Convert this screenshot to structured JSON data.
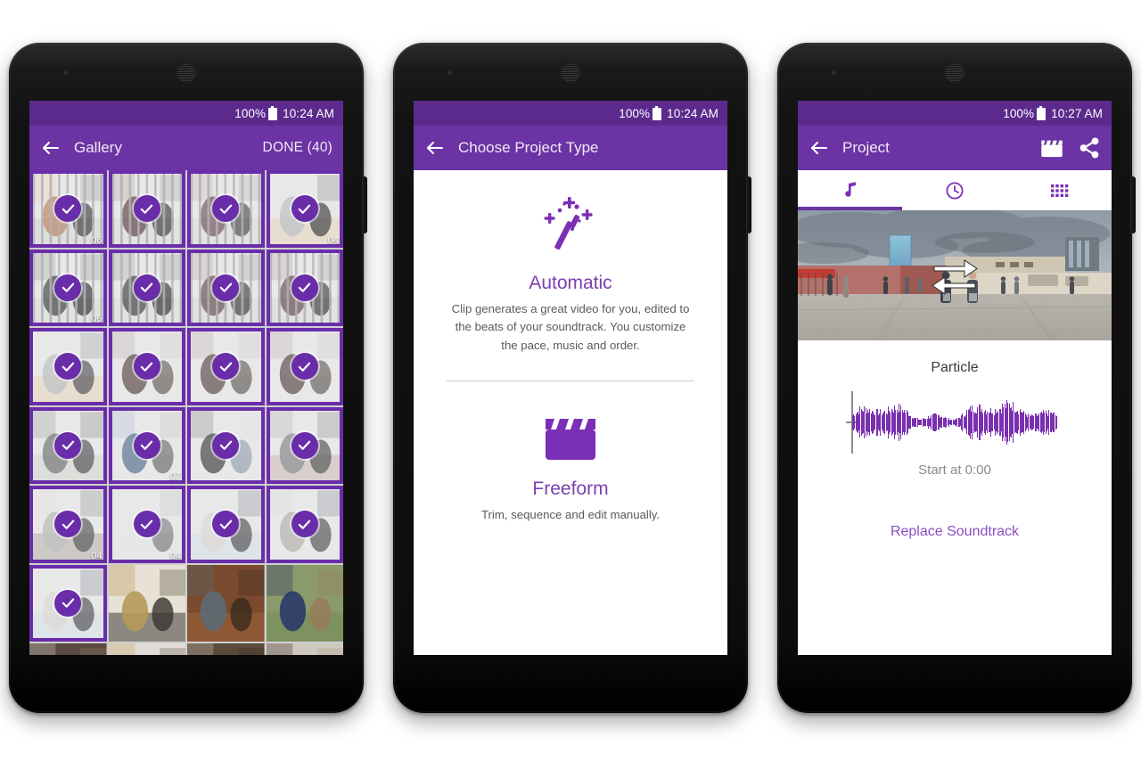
{
  "app": {
    "accent_purple": "#6b33a3",
    "accent_purple_dark": "#5b2a8c",
    "accent_purple_light": "#8a4fc0",
    "checkmark_circle": "#6a2daa"
  },
  "phone1": {
    "status": {
      "battery": "100%",
      "time": "10:24 AM",
      "battery_icon": "battery-icon"
    },
    "appbar": {
      "back_icon": "back-arrow-icon",
      "title": "Gallery",
      "done_label": "DONE (40)"
    },
    "grid": {
      "columns": 4,
      "items": [
        {
          "selected": true,
          "duration": "06",
          "scene": "cage-two-people"
        },
        {
          "selected": true,
          "duration": "",
          "scene": "cage-woman-swing"
        },
        {
          "selected": true,
          "duration": "",
          "scene": "cage-woman-stand"
        },
        {
          "selected": true,
          "duration": "04",
          "scene": "orange-car"
        },
        {
          "selected": true,
          "duration": "06",
          "scene": "cage-woman-arms"
        },
        {
          "selected": true,
          "duration": "",
          "scene": "cage-woman-arms2"
        },
        {
          "selected": true,
          "duration": "",
          "scene": "cage-woman-dress"
        },
        {
          "selected": true,
          "duration": "",
          "scene": "cage-woman-dress2"
        },
        {
          "selected": true,
          "duration": "",
          "scene": "orange-car-close"
        },
        {
          "selected": true,
          "duration": "",
          "scene": "tree-gallery"
        },
        {
          "selected": true,
          "duration": "",
          "scene": "tree-gallery2"
        },
        {
          "selected": true,
          "duration": "",
          "scene": "tree-gallery3"
        },
        {
          "selected": true,
          "duration": "",
          "scene": "street-crowd"
        },
        {
          "selected": true,
          "duration": "07",
          "scene": "wall-224"
        },
        {
          "selected": true,
          "duration": "",
          "scene": "graffiti-wall"
        },
        {
          "selected": true,
          "duration": "",
          "scene": "street-people"
        },
        {
          "selected": true,
          "duration": "04",
          "scene": "pillar-street"
        },
        {
          "selected": true,
          "duration": "04",
          "scene": "woman-stripes"
        },
        {
          "selected": true,
          "duration": "",
          "scene": "plaza-tower"
        },
        {
          "selected": true,
          "duration": "",
          "scene": "plaza-wide"
        },
        {
          "selected": true,
          "duration": "",
          "scene": "plaza-tower2"
        },
        {
          "selected": false,
          "duration": "",
          "scene": "vintage-camera"
        },
        {
          "selected": false,
          "duration": "",
          "scene": "bird-ceiling"
        },
        {
          "selected": false,
          "duration": "",
          "scene": "succulent-plant"
        },
        {
          "selected": false,
          "duration": "",
          "scene": "dark-door"
        },
        {
          "selected": false,
          "duration": "",
          "scene": "window-room"
        },
        {
          "selected": false,
          "duration": "",
          "scene": "stairs"
        },
        {
          "selected": false,
          "duration": "",
          "scene": "interior-people"
        }
      ]
    }
  },
  "phone2": {
    "status": {
      "battery": "100%",
      "time": "10:24 AM"
    },
    "appbar": {
      "back_icon": "back-arrow-icon",
      "title": "Choose Project Type"
    },
    "options": [
      {
        "icon": "magic-wand-icon",
        "name": "Automatic",
        "description": "Clip generates a great video for you, edited to the beats of your soundtrack. You customize the pace, music and order."
      },
      {
        "icon": "clapperboard-icon",
        "name": "Freeform",
        "description": "Trim, sequence and edit manually."
      }
    ]
  },
  "phone3": {
    "status": {
      "battery": "100%",
      "time": "10:27 AM"
    },
    "appbar": {
      "back_icon": "back-arrow-icon",
      "title": "Project",
      "clapper_icon": "clapperboard-icon",
      "share_icon": "share-icon"
    },
    "tabs": [
      {
        "icon": "music-note-icon",
        "active": true
      },
      {
        "icon": "clock-icon",
        "active": false
      },
      {
        "icon": "grid-icon",
        "active": false
      }
    ],
    "preview": {
      "overlay_icon": "swap-arrows-icon",
      "scene": "city-plaza-crowd"
    },
    "soundtrack": {
      "track_name": "Particle",
      "start_label": "Start at 0:00",
      "replace_label": "Replace Soundtrack",
      "waveform_icon": "audio-waveform"
    }
  }
}
